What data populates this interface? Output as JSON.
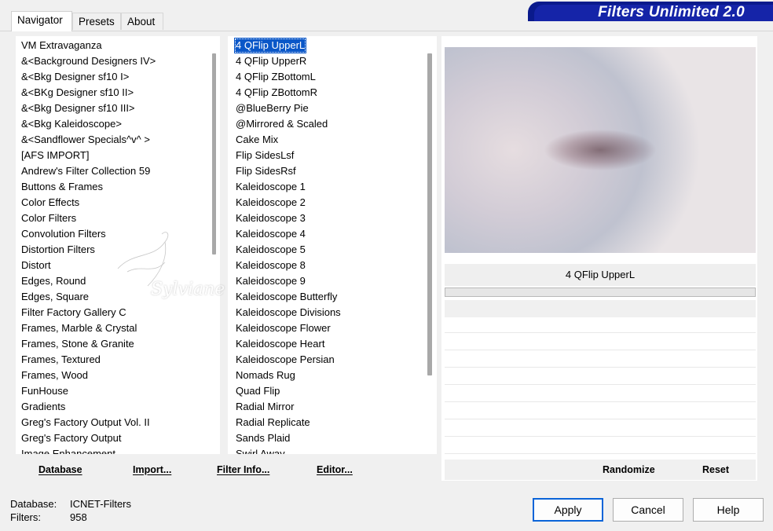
{
  "tabs": [
    {
      "label": "Navigator"
    },
    {
      "label": "Presets"
    },
    {
      "label": "About"
    }
  ],
  "brand": {
    "title": "Filters Unlimited 2.0",
    "color": "#1524a8"
  },
  "categories": {
    "items": [
      "VM Extravaganza",
      "&<Background Designers IV>",
      "&<Bkg Designer sf10 I>",
      "&<BKg Designer sf10 II>",
      "&<Bkg Designer sf10 III>",
      "&<Bkg Kaleidoscope>",
      "&<Sandflower Specials^v^ >",
      "[AFS IMPORT]",
      "Andrew's Filter Collection 59",
      "Buttons & Frames",
      "Color Effects",
      "Color Filters",
      "Convolution Filters",
      "Distortion Filters",
      "Distort",
      "Edges, Round",
      "Edges, Square",
      "Filter Factory Gallery C",
      "Frames, Marble & Crystal",
      "Frames, Stone & Granite",
      "Frames, Textured",
      "Frames, Wood",
      "FunHouse",
      "Gradients",
      "Greg's Factory Output Vol. II",
      "Greg's Factory Output",
      "Image Enhancement"
    ]
  },
  "filters": {
    "selected_index": 0,
    "items": [
      "4 QFlip UpperL",
      "4 QFlip UpperR",
      "4 QFlip ZBottomL",
      "4 QFlip ZBottomR",
      "@BlueBerry Pie",
      "@Mirrored & Scaled",
      "Cake Mix",
      "Flip SidesLsf",
      "Flip SidesRsf",
      "Kaleidoscope 1",
      "Kaleidoscope 2",
      "Kaleidoscope 3",
      "Kaleidoscope 4",
      "Kaleidoscope 5",
      "Kaleidoscope 8",
      "Kaleidoscope 9",
      "Kaleidoscope Butterfly",
      "Kaleidoscope Divisions",
      "Kaleidoscope Flower",
      "Kaleidoscope Heart",
      "Kaleidoscope Persian",
      "Nomads Rug",
      "Quad Flip",
      "Radial Mirror",
      "Radial Replicate",
      "Sands Plaid",
      "Swirl Away"
    ]
  },
  "toolbar": {
    "database": "Database",
    "import": "Import...",
    "filter_info": "Filter Info...",
    "editor": "Editor...",
    "randomize": "Randomize",
    "reset": "Reset"
  },
  "preview": {
    "current_filter": "4 QFlip UpperL"
  },
  "watermark": {
    "text": "Sylviane"
  },
  "status": {
    "database_label": "Database:",
    "database_value": "ICNET-Filters",
    "filters_label": "Filters:",
    "filters_value": "958"
  },
  "buttons": {
    "apply": "Apply",
    "cancel": "Cancel",
    "help": "Help"
  }
}
